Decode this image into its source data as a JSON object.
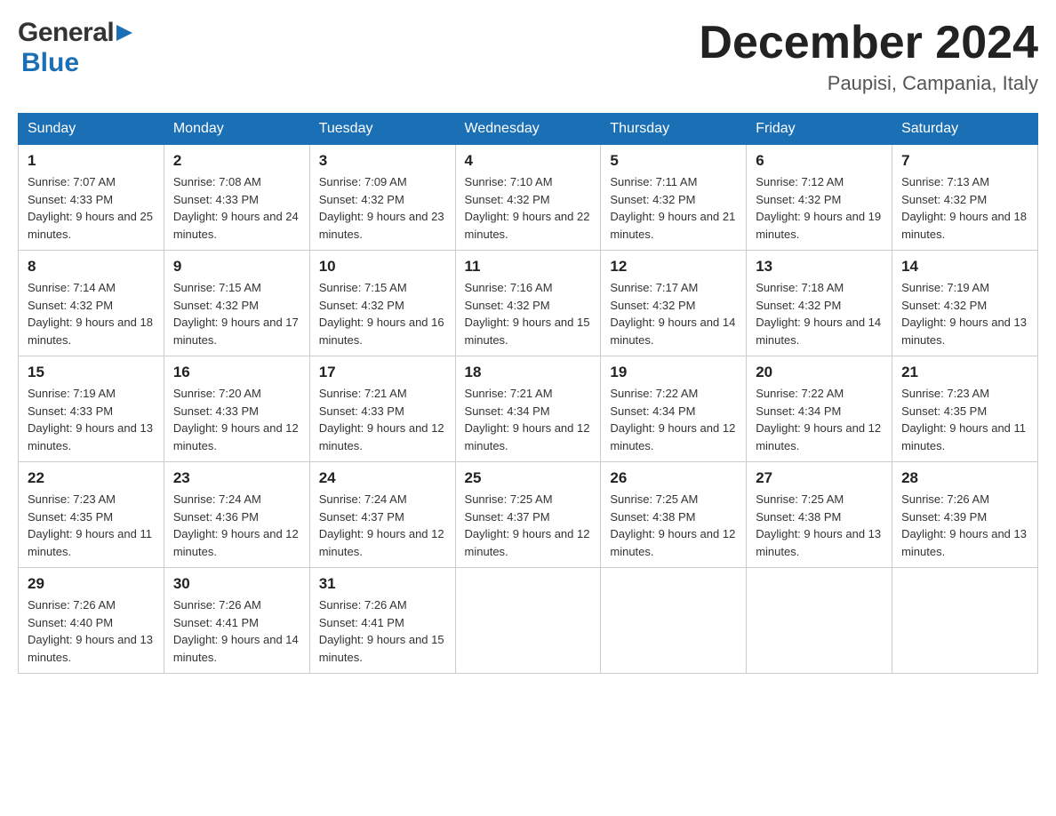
{
  "header": {
    "logo_general": "General",
    "logo_blue": "Blue",
    "title": "December 2024",
    "location": "Paupisi, Campania, Italy"
  },
  "days_of_week": [
    "Sunday",
    "Monday",
    "Tuesday",
    "Wednesday",
    "Thursday",
    "Friday",
    "Saturday"
  ],
  "weeks": [
    [
      {
        "num": "1",
        "sunrise": "7:07 AM",
        "sunset": "4:33 PM",
        "daylight": "9 hours and 25 minutes."
      },
      {
        "num": "2",
        "sunrise": "7:08 AM",
        "sunset": "4:33 PM",
        "daylight": "9 hours and 24 minutes."
      },
      {
        "num": "3",
        "sunrise": "7:09 AM",
        "sunset": "4:32 PM",
        "daylight": "9 hours and 23 minutes."
      },
      {
        "num": "4",
        "sunrise": "7:10 AM",
        "sunset": "4:32 PM",
        "daylight": "9 hours and 22 minutes."
      },
      {
        "num": "5",
        "sunrise": "7:11 AM",
        "sunset": "4:32 PM",
        "daylight": "9 hours and 21 minutes."
      },
      {
        "num": "6",
        "sunrise": "7:12 AM",
        "sunset": "4:32 PM",
        "daylight": "9 hours and 19 minutes."
      },
      {
        "num": "7",
        "sunrise": "7:13 AM",
        "sunset": "4:32 PM",
        "daylight": "9 hours and 18 minutes."
      }
    ],
    [
      {
        "num": "8",
        "sunrise": "7:14 AM",
        "sunset": "4:32 PM",
        "daylight": "9 hours and 18 minutes."
      },
      {
        "num": "9",
        "sunrise": "7:15 AM",
        "sunset": "4:32 PM",
        "daylight": "9 hours and 17 minutes."
      },
      {
        "num": "10",
        "sunrise": "7:15 AM",
        "sunset": "4:32 PM",
        "daylight": "9 hours and 16 minutes."
      },
      {
        "num": "11",
        "sunrise": "7:16 AM",
        "sunset": "4:32 PM",
        "daylight": "9 hours and 15 minutes."
      },
      {
        "num": "12",
        "sunrise": "7:17 AM",
        "sunset": "4:32 PM",
        "daylight": "9 hours and 14 minutes."
      },
      {
        "num": "13",
        "sunrise": "7:18 AM",
        "sunset": "4:32 PM",
        "daylight": "9 hours and 14 minutes."
      },
      {
        "num": "14",
        "sunrise": "7:19 AM",
        "sunset": "4:32 PM",
        "daylight": "9 hours and 13 minutes."
      }
    ],
    [
      {
        "num": "15",
        "sunrise": "7:19 AM",
        "sunset": "4:33 PM",
        "daylight": "9 hours and 13 minutes."
      },
      {
        "num": "16",
        "sunrise": "7:20 AM",
        "sunset": "4:33 PM",
        "daylight": "9 hours and 12 minutes."
      },
      {
        "num": "17",
        "sunrise": "7:21 AM",
        "sunset": "4:33 PM",
        "daylight": "9 hours and 12 minutes."
      },
      {
        "num": "18",
        "sunrise": "7:21 AM",
        "sunset": "4:34 PM",
        "daylight": "9 hours and 12 minutes."
      },
      {
        "num": "19",
        "sunrise": "7:22 AM",
        "sunset": "4:34 PM",
        "daylight": "9 hours and 12 minutes."
      },
      {
        "num": "20",
        "sunrise": "7:22 AM",
        "sunset": "4:34 PM",
        "daylight": "9 hours and 12 minutes."
      },
      {
        "num": "21",
        "sunrise": "7:23 AM",
        "sunset": "4:35 PM",
        "daylight": "9 hours and 11 minutes."
      }
    ],
    [
      {
        "num": "22",
        "sunrise": "7:23 AM",
        "sunset": "4:35 PM",
        "daylight": "9 hours and 11 minutes."
      },
      {
        "num": "23",
        "sunrise": "7:24 AM",
        "sunset": "4:36 PM",
        "daylight": "9 hours and 12 minutes."
      },
      {
        "num": "24",
        "sunrise": "7:24 AM",
        "sunset": "4:37 PM",
        "daylight": "9 hours and 12 minutes."
      },
      {
        "num": "25",
        "sunrise": "7:25 AM",
        "sunset": "4:37 PM",
        "daylight": "9 hours and 12 minutes."
      },
      {
        "num": "26",
        "sunrise": "7:25 AM",
        "sunset": "4:38 PM",
        "daylight": "9 hours and 12 minutes."
      },
      {
        "num": "27",
        "sunrise": "7:25 AM",
        "sunset": "4:38 PM",
        "daylight": "9 hours and 13 minutes."
      },
      {
        "num": "28",
        "sunrise": "7:26 AM",
        "sunset": "4:39 PM",
        "daylight": "9 hours and 13 minutes."
      }
    ],
    [
      {
        "num": "29",
        "sunrise": "7:26 AM",
        "sunset": "4:40 PM",
        "daylight": "9 hours and 13 minutes."
      },
      {
        "num": "30",
        "sunrise": "7:26 AM",
        "sunset": "4:41 PM",
        "daylight": "9 hours and 14 minutes."
      },
      {
        "num": "31",
        "sunrise": "7:26 AM",
        "sunset": "4:41 PM",
        "daylight": "9 hours and 15 minutes."
      },
      null,
      null,
      null,
      null
    ]
  ],
  "labels": {
    "sunrise_prefix": "Sunrise: ",
    "sunset_prefix": "Sunset: ",
    "daylight_prefix": "Daylight: "
  }
}
